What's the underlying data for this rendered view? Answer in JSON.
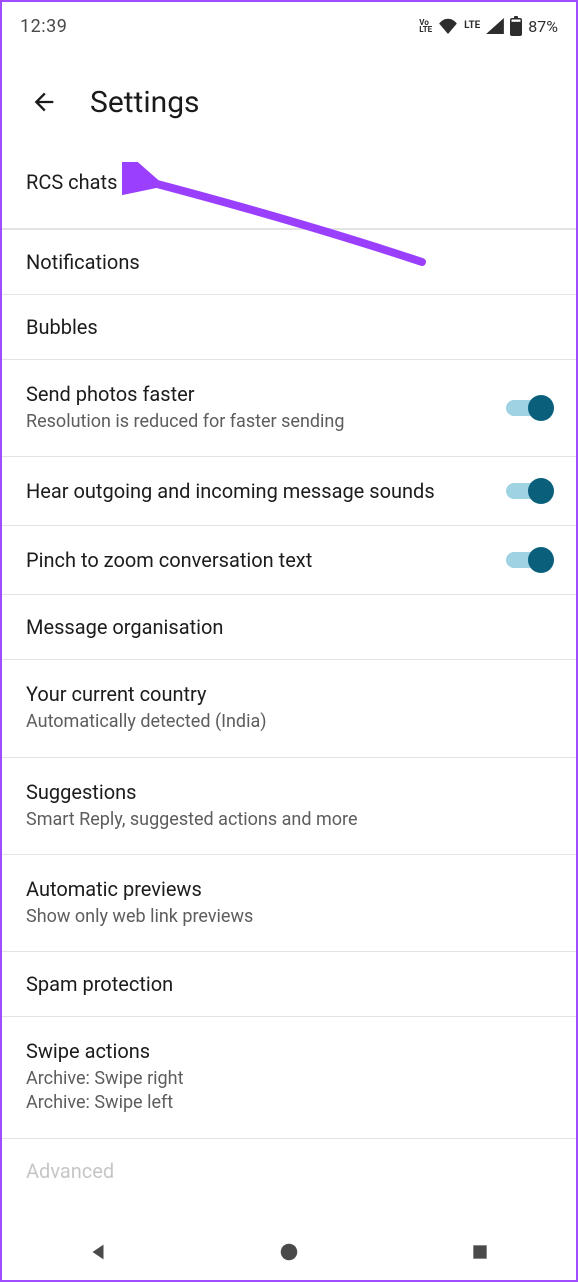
{
  "status": {
    "time": "12:39",
    "volte": "Vo\nLTE",
    "lte": "LTE",
    "battery": "87%"
  },
  "header": {
    "title": "Settings"
  },
  "items": {
    "rcs": {
      "title": "RCS chats"
    },
    "notifications": {
      "title": "Notifications"
    },
    "bubbles": {
      "title": "Bubbles"
    },
    "send_photos": {
      "title": "Send photos faster",
      "subtitle": "Resolution is reduced for faster sending",
      "toggled": true
    },
    "hear_sounds": {
      "title": "Hear outgoing and incoming message sounds",
      "toggled": true
    },
    "pinch_zoom": {
      "title": "Pinch to zoom conversation text",
      "toggled": true
    },
    "organisation": {
      "title": "Message organisation"
    },
    "country": {
      "title": "Your current country",
      "subtitle": "Automatically detected (India)"
    },
    "suggestions": {
      "title": "Suggestions",
      "subtitle": "Smart Reply, suggested actions and more"
    },
    "previews": {
      "title": "Automatic previews",
      "subtitle": "Show only web link previews"
    },
    "spam": {
      "title": "Spam protection"
    },
    "swipe": {
      "title": "Swipe actions",
      "subtitle": "Archive: Swipe right\nArchive: Swipe left"
    },
    "advanced": {
      "title": "Advanced"
    }
  },
  "colors": {
    "accent": "#0a5f7a",
    "track": "#9fd2e2",
    "arrow": "#9b3fff",
    "border": "#a04dff"
  }
}
